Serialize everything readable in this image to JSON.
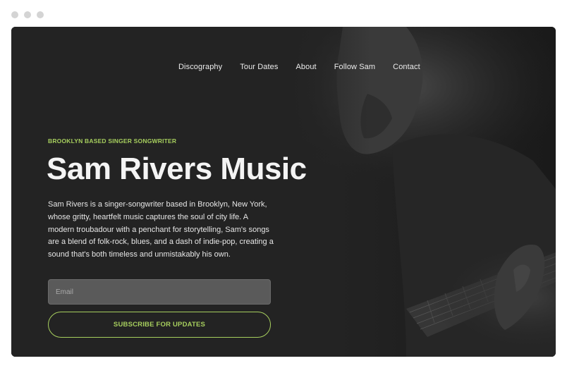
{
  "window": {
    "controls": [
      "close",
      "minimize",
      "maximize"
    ]
  },
  "nav": {
    "items": [
      "Discography",
      "Tour Dates",
      "About",
      "Follow Sam",
      "Contact"
    ]
  },
  "hero": {
    "eyebrow": "BROOKLYN BASED SINGER SONGWRITER",
    "title": "Sam Rivers Music",
    "bio": "Sam Rivers is a singer-songwriter based in Brooklyn, New York, whose gritty, heartfelt music captures the soul of city life. A modern troubadour with a penchant for storytelling, Sam's songs are a blend of folk-rock, blues, and a dash of indie-pop, creating a sound that's both timeless and unmistakably his own.",
    "email_placeholder": "Email",
    "subscribe_label": "SUBSCRIBE FOR UPDATES"
  },
  "colors": {
    "background": "#232323",
    "accent": "#a7cf5e",
    "text": "#f4f4f4",
    "input_bg": "#5a5a5a"
  }
}
